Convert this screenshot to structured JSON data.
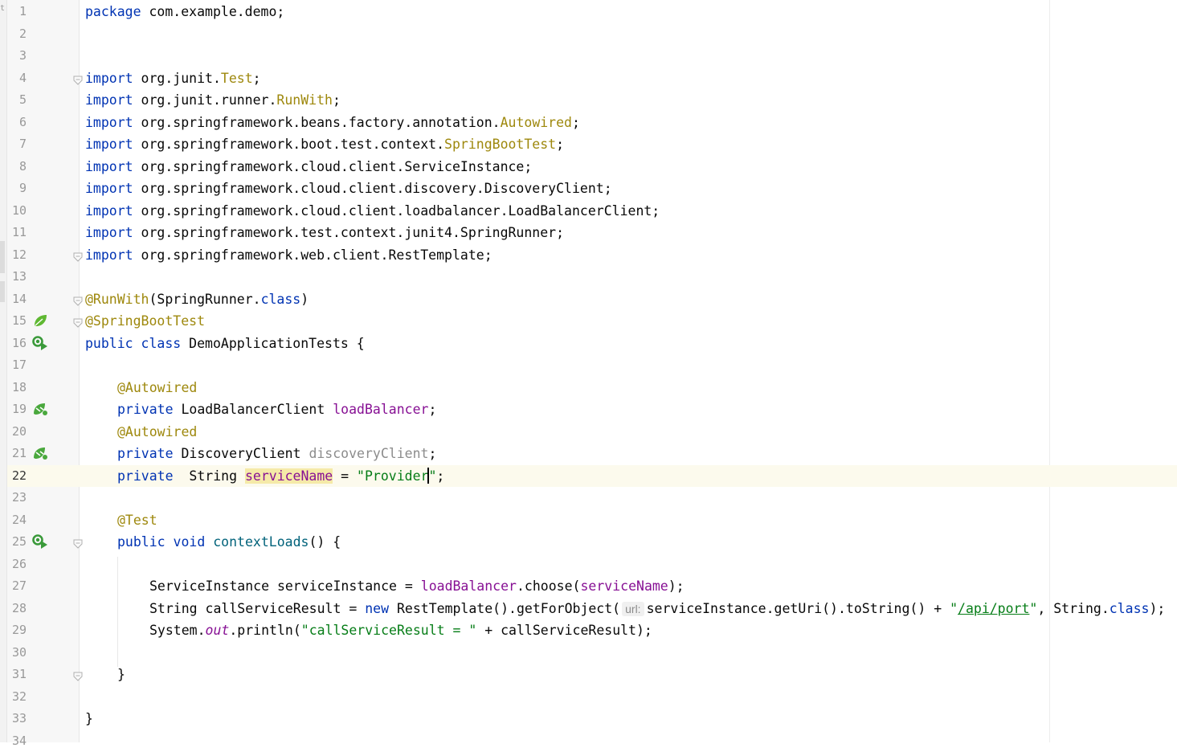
{
  "editor": {
    "left_strip_text": "t",
    "current_line": 22,
    "colors": {
      "keyword": "#0033b3",
      "annotation": "#9e880d",
      "field": "#871094",
      "string": "#067d17",
      "unused": "#8c8c8c",
      "line_numbers": "#999999",
      "current_line_bg": "#fcfaed"
    },
    "gutter_icons": [
      {
        "line": 15,
        "icon": "spring-bean-leaf-icon"
      },
      {
        "line": 16,
        "icon": "run-test-icon"
      },
      {
        "line": 19,
        "icon": "spring-autowired-icon"
      },
      {
        "line": 21,
        "icon": "spring-autowired-icon"
      },
      {
        "line": 25,
        "icon": "run-test-icon"
      }
    ],
    "fold_markers": [
      4,
      12,
      14,
      15,
      25,
      31
    ],
    "lines": [
      {
        "n": 1,
        "indent": 0,
        "tokens": [
          {
            "t": "package",
            "c": "kw"
          },
          {
            "t": " com.example.demo;"
          }
        ]
      },
      {
        "n": 2,
        "indent": 0,
        "tokens": []
      },
      {
        "n": 3,
        "indent": 0,
        "tokens": []
      },
      {
        "n": 4,
        "indent": 0,
        "tokens": [
          {
            "t": "import",
            "c": "kw"
          },
          {
            "t": " org.junit."
          },
          {
            "t": "Test",
            "c": "ann"
          },
          {
            "t": ";"
          }
        ]
      },
      {
        "n": 5,
        "indent": 0,
        "tokens": [
          {
            "t": "import",
            "c": "kw"
          },
          {
            "t": " org.junit.runner."
          },
          {
            "t": "RunWith",
            "c": "ann"
          },
          {
            "t": ";"
          }
        ]
      },
      {
        "n": 6,
        "indent": 0,
        "tokens": [
          {
            "t": "import",
            "c": "kw"
          },
          {
            "t": " org.springframework.beans.factory.annotation."
          },
          {
            "t": "Autowired",
            "c": "ann"
          },
          {
            "t": ";"
          }
        ]
      },
      {
        "n": 7,
        "indent": 0,
        "tokens": [
          {
            "t": "import",
            "c": "kw"
          },
          {
            "t": " org.springframework.boot.test.context."
          },
          {
            "t": "SpringBootTest",
            "c": "ann"
          },
          {
            "t": ";"
          }
        ]
      },
      {
        "n": 8,
        "indent": 0,
        "tokens": [
          {
            "t": "import",
            "c": "kw"
          },
          {
            "t": " org.springframework.cloud.client.ServiceInstance;"
          }
        ]
      },
      {
        "n": 9,
        "indent": 0,
        "tokens": [
          {
            "t": "import",
            "c": "kw"
          },
          {
            "t": " org.springframework.cloud.client.discovery.DiscoveryClient;"
          }
        ]
      },
      {
        "n": 10,
        "indent": 0,
        "tokens": [
          {
            "t": "import",
            "c": "kw"
          },
          {
            "t": " org.springframework.cloud.client.loadbalancer.LoadBalancerClient;"
          }
        ]
      },
      {
        "n": 11,
        "indent": 0,
        "tokens": [
          {
            "t": "import",
            "c": "kw"
          },
          {
            "t": " org.springframework.test.context.junit4.SpringRunner;"
          }
        ]
      },
      {
        "n": 12,
        "indent": 0,
        "tokens": [
          {
            "t": "import",
            "c": "kw"
          },
          {
            "t": " org.springframework.web.client.RestTemplate;"
          }
        ]
      },
      {
        "n": 13,
        "indent": 0,
        "tokens": []
      },
      {
        "n": 14,
        "indent": 0,
        "tokens": [
          {
            "t": "@RunWith",
            "c": "ann"
          },
          {
            "t": "(SpringRunner."
          },
          {
            "t": "class",
            "c": "kw"
          },
          {
            "t": ")"
          }
        ]
      },
      {
        "n": 15,
        "indent": 0,
        "tokens": [
          {
            "t": "@SpringBootTest",
            "c": "ann"
          }
        ]
      },
      {
        "n": 16,
        "indent": 0,
        "tokens": [
          {
            "t": "public",
            "c": "kw"
          },
          {
            "t": " "
          },
          {
            "t": "class",
            "c": "kw"
          },
          {
            "t": " DemoApplicationTests {"
          }
        ]
      },
      {
        "n": 17,
        "indent": 0,
        "tokens": []
      },
      {
        "n": 18,
        "indent": 1,
        "tokens": [
          {
            "t": "@Autowired",
            "c": "ann"
          }
        ]
      },
      {
        "n": 19,
        "indent": 1,
        "tokens": [
          {
            "t": "private",
            "c": "kw"
          },
          {
            "t": " LoadBalancerClient "
          },
          {
            "t": "loadBalancer",
            "c": "field"
          },
          {
            "t": ";"
          }
        ]
      },
      {
        "n": 20,
        "indent": 1,
        "tokens": [
          {
            "t": "@Autowired",
            "c": "ann"
          }
        ]
      },
      {
        "n": 21,
        "indent": 1,
        "tokens": [
          {
            "t": "private",
            "c": "kw"
          },
          {
            "t": " DiscoveryClient "
          },
          {
            "t": "discoveryClient",
            "c": "unused"
          },
          {
            "t": ";"
          }
        ]
      },
      {
        "n": 22,
        "indent": 1,
        "tokens": [
          {
            "t": "private",
            "c": "kw"
          },
          {
            "t": "  String "
          },
          {
            "t": "serviceName",
            "c": "field hl"
          },
          {
            "t": " = "
          },
          {
            "t": "\"Provider",
            "c": "str"
          },
          {
            "t": "",
            "c": "caret"
          },
          {
            "t": "\"",
            "c": "str"
          },
          {
            "t": ";"
          }
        ]
      },
      {
        "n": 23,
        "indent": 0,
        "tokens": []
      },
      {
        "n": 24,
        "indent": 1,
        "tokens": [
          {
            "t": "@Test",
            "c": "ann"
          }
        ]
      },
      {
        "n": 25,
        "indent": 1,
        "tokens": [
          {
            "t": "public",
            "c": "kw"
          },
          {
            "t": " "
          },
          {
            "t": "void",
            "c": "kw"
          },
          {
            "t": " "
          },
          {
            "t": "contextLoads",
            "c": "method-decl"
          },
          {
            "t": "() {"
          }
        ]
      },
      {
        "n": 26,
        "indent": 0,
        "tokens": []
      },
      {
        "n": 27,
        "indent": 2,
        "tokens": [
          {
            "t": "ServiceInstance serviceInstance = "
          },
          {
            "t": "loadBalancer",
            "c": "field"
          },
          {
            "t": ".choose("
          },
          {
            "t": "serviceName",
            "c": "field"
          },
          {
            "t": ");"
          }
        ]
      },
      {
        "n": 28,
        "indent": 2,
        "tokens": [
          {
            "t": "String callServiceResult = "
          },
          {
            "t": "new",
            "c": "kw"
          },
          {
            "t": " RestTemplate().getForObject("
          },
          {
            "t": "url:",
            "c": "hint"
          },
          {
            "t": "serviceInstance.getUri().toString() + "
          },
          {
            "t": "\"",
            "c": "str"
          },
          {
            "t": "/api/port",
            "c": "str-link"
          },
          {
            "t": "\"",
            "c": "str"
          },
          {
            "t": ", String."
          },
          {
            "t": "class",
            "c": "kw"
          },
          {
            "t": ");"
          }
        ]
      },
      {
        "n": 29,
        "indent": 2,
        "tokens": [
          {
            "t": "System."
          },
          {
            "t": "out",
            "c": "static-f"
          },
          {
            "t": ".println("
          },
          {
            "t": "\"callServiceResult = \"",
            "c": "str"
          },
          {
            "t": " + callServiceResult);"
          }
        ]
      },
      {
        "n": 30,
        "indent": 0,
        "tokens": []
      },
      {
        "n": 31,
        "indent": 1,
        "tokens": [
          {
            "t": "}"
          }
        ]
      },
      {
        "n": 32,
        "indent": 0,
        "tokens": []
      },
      {
        "n": 33,
        "indent": 0,
        "tokens": [
          {
            "t": "}"
          }
        ]
      },
      {
        "n": 34,
        "indent": 0,
        "tokens": []
      }
    ]
  }
}
